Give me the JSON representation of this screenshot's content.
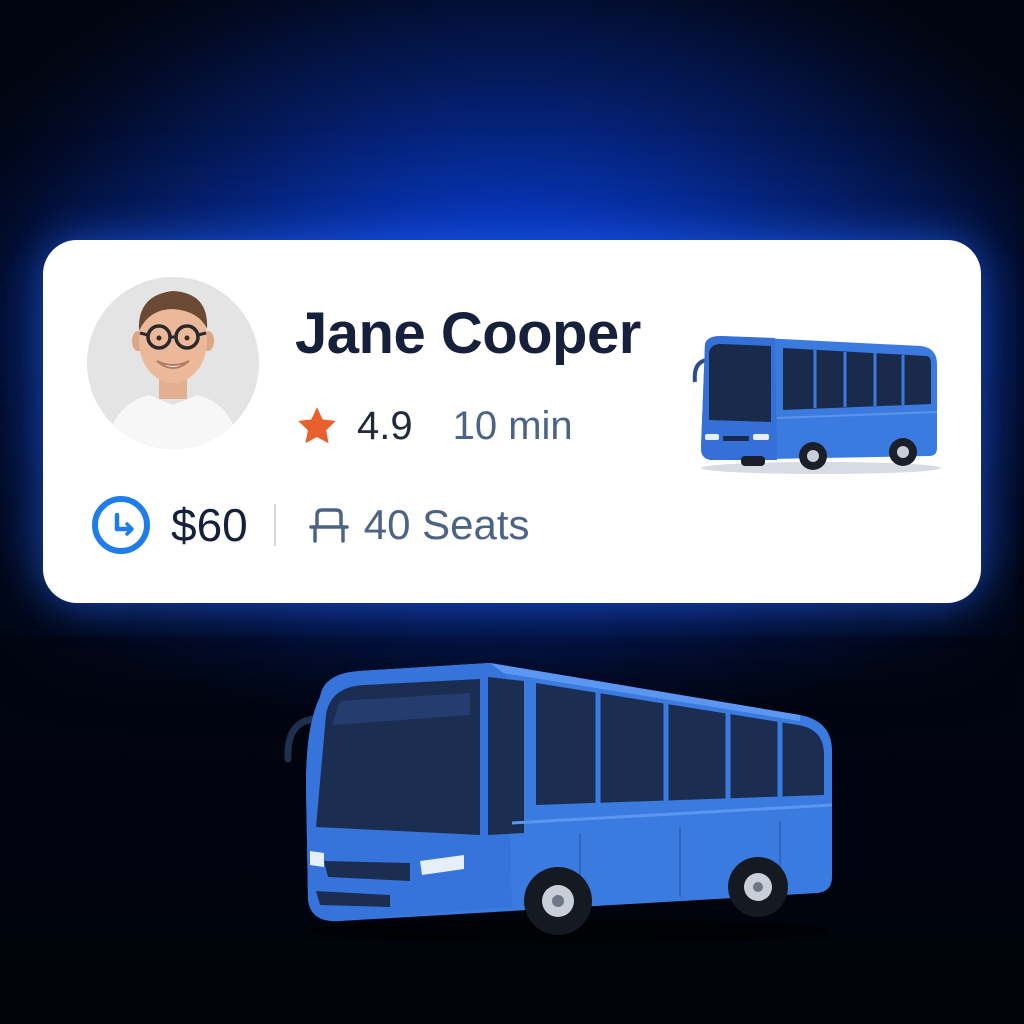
{
  "driver": {
    "name": "Jane Cooper",
    "avatar_icon": "person-avatar"
  },
  "rating": {
    "icon": "star-icon",
    "value": "4.9",
    "eta": "10 min"
  },
  "trip": {
    "price_icon": "clock-icon",
    "price": "$60",
    "seats_icon": "seat-icon",
    "seats": "40 Seats"
  },
  "colors": {
    "accent_blue": "#1e7de8",
    "star_orange": "#e8612c",
    "bus_blue": "#3b7be0",
    "text_dark": "#16203a",
    "text_muted": "#4c6385"
  }
}
